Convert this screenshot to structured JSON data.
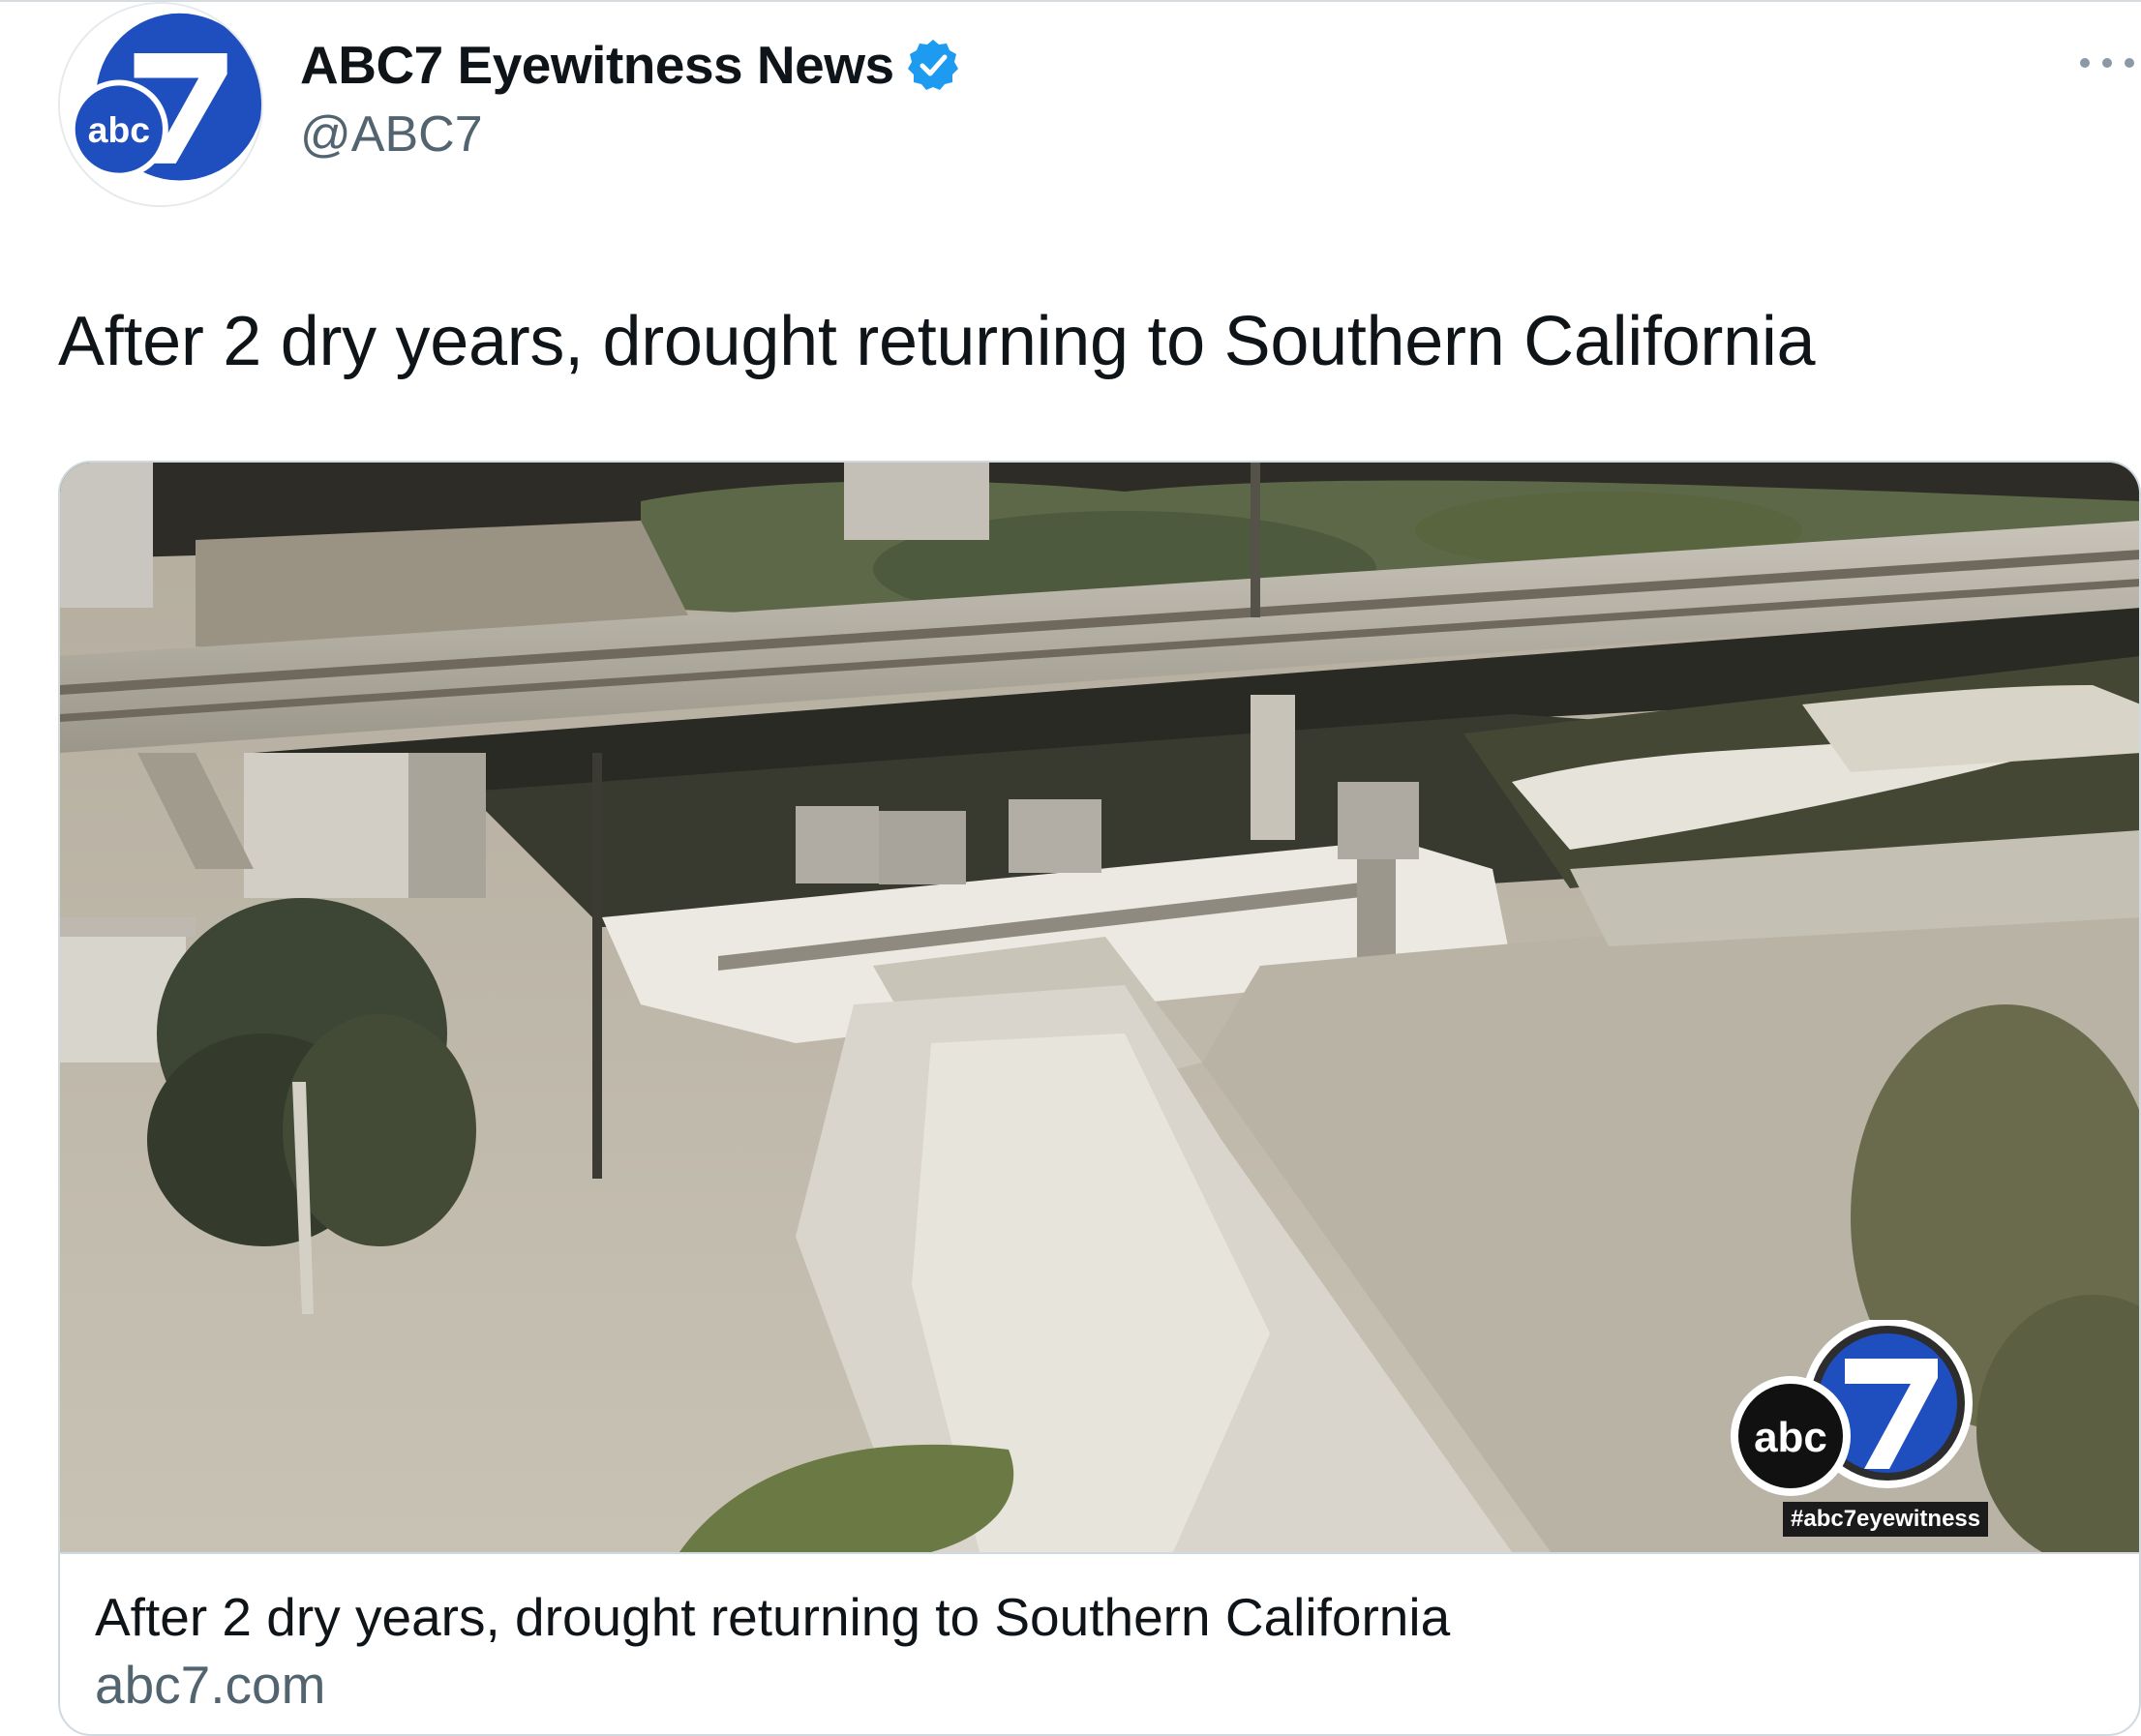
{
  "tweet": {
    "author": {
      "display_name": "ABC7 Eyewitness News",
      "handle": "@ABC7",
      "verified": true,
      "avatar_logo_text": "abc",
      "avatar_icon": "abc7-logo-icon"
    },
    "more_icon": "more-icon",
    "text": "After 2 dry years, drought returning to Southern California",
    "card": {
      "title": "After 2 dry years, drought returning to Southern California",
      "domain": "abc7.com",
      "watermark": {
        "logo_text": "abc",
        "hashtag": "#abc7eyewitness"
      }
    }
  },
  "colors": {
    "brand_blue": "#1f4fbf",
    "verified_blue": "#1d9bf0",
    "secondary_text": "#536471",
    "border": "#cfd9de"
  }
}
